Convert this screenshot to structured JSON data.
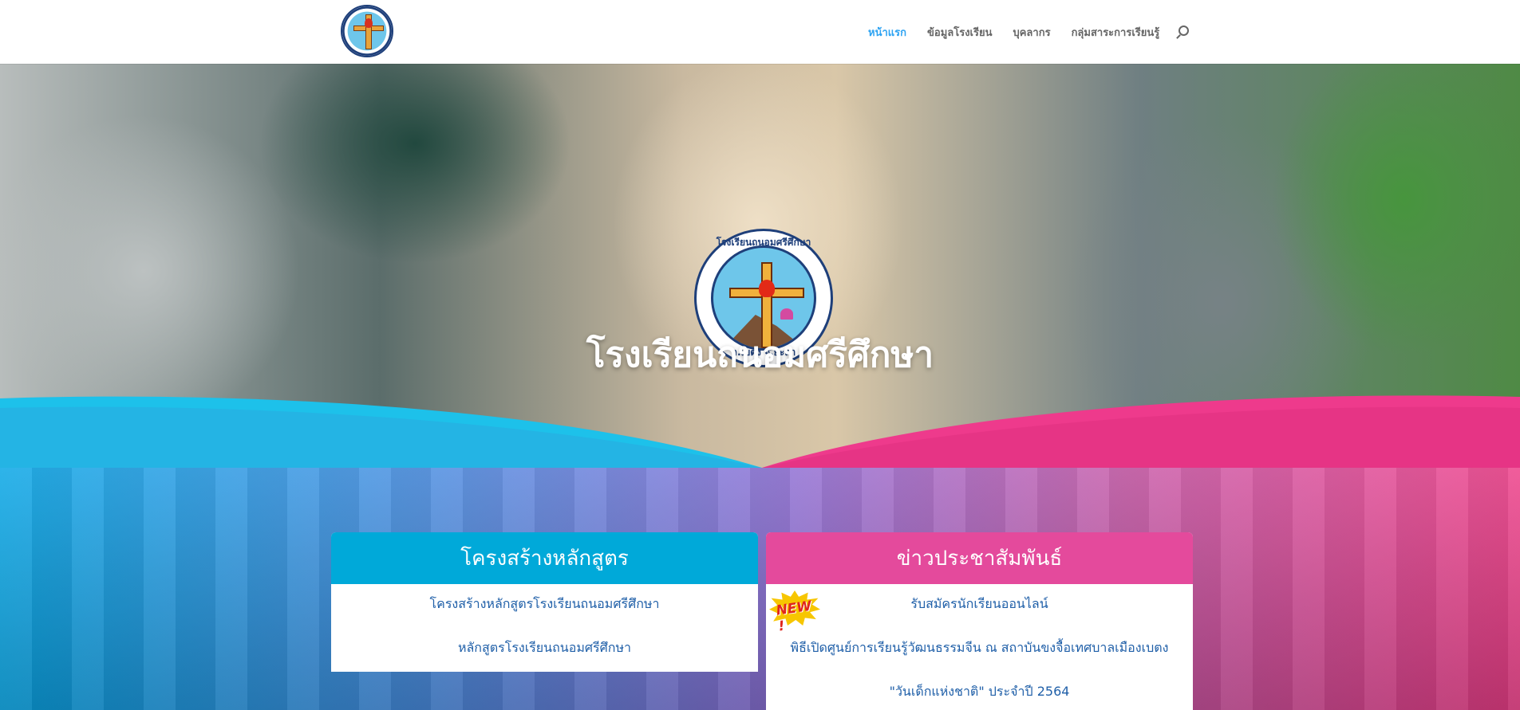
{
  "header": {
    "logo_alt": "",
    "nav": [
      {
        "label": "หน้าแรก",
        "active": true
      },
      {
        "label": "ข้อมูลโรงเรียน",
        "active": false
      },
      {
        "label": "บุคลากร",
        "active": false
      },
      {
        "label": "กลุ่มสาระการเรียนรู้",
        "active": false
      }
    ],
    "search_icon": "search-icon"
  },
  "hero": {
    "emblem": {
      "top_text": "โรงเรียนถนอมศรีศึกษา",
      "bottom_text": "อ.เบตง จ.ยะลา"
    },
    "title": "โรงเรียนถนอมศรีศึกษา"
  },
  "colors": {
    "cyan": "#00a9d9",
    "pink": "#e44a9c",
    "link": "#1f5fa8",
    "nav_active": "#2ea3f2"
  },
  "cards": {
    "curriculum": {
      "title": "โครงสร้างหลักสูตร",
      "links": [
        "โครงสร้างหลักสูตรโรงเรียนถนอมศรีศึกษา",
        "หลักสูตรโรงเรียนถนอมศรีศึกษา"
      ]
    },
    "news": {
      "title": "ข่าวประชาสัมพันธ์",
      "badge": "NEW !",
      "links": [
        "รับสมัครนักเรียนออนไลน์",
        "พิธีเปิดศูนย์การเรียนรู้วัฒนธรรมจีน ณ สถาบันขงจื้อเทศบาลเมืองเบตง",
        "\"วันเด็กแห่งชาติ\" ประจำปี 2564"
      ]
    }
  }
}
